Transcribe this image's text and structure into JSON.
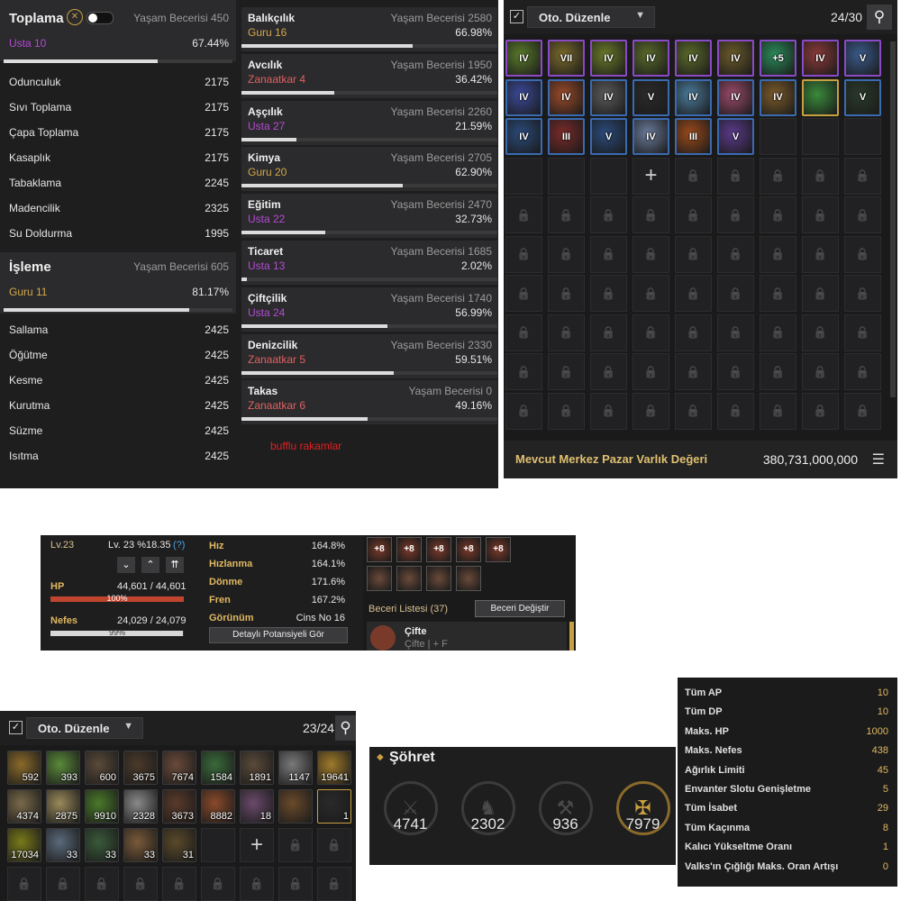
{
  "life": {
    "toplama": {
      "title": "Toplama",
      "life_skill": "Yaşam Becerisi 450",
      "rank": "Usta 10",
      "percent": "67.44%",
      "progress": 0.6744,
      "subs": [
        {
          "name": "Odunculuk",
          "value": "2175"
        },
        {
          "name": "Sıvı Toplama",
          "value": "2175"
        },
        {
          "name": "Çapa Toplama",
          "value": "2175"
        },
        {
          "name": "Kasaplık",
          "value": "2175"
        },
        {
          "name": "Tabaklama",
          "value": "2245"
        },
        {
          "name": "Madencilik",
          "value": "2325"
        },
        {
          "name": "Su Doldurma",
          "value": "1995"
        }
      ]
    },
    "isleme": {
      "title": "İşleme",
      "life_skill": "Yaşam Becerisi 605",
      "rank": "Guru 11",
      "percent": "81.17%",
      "progress": 0.8117,
      "subs": [
        {
          "name": "Sallama",
          "value": "2425"
        },
        {
          "name": "Öğütme",
          "value": "2425"
        },
        {
          "name": "Kesme",
          "value": "2425"
        },
        {
          "name": "Kurutma",
          "value": "2425"
        },
        {
          "name": "Süzme",
          "value": "2425"
        },
        {
          "name": "Isıtma",
          "value": "2425"
        }
      ]
    },
    "skills": [
      {
        "title": "Balıkçılık",
        "life_skill": "Yaşam Becerisi 2580",
        "rank": "Guru 16",
        "rank_kind": "guru",
        "percent": "66.98%",
        "progress": 0.6698
      },
      {
        "title": "Avcılık",
        "life_skill": "Yaşam Becerisi 1950",
        "rank": "Zanaatkar 4",
        "rank_kind": "zan",
        "percent": "36.42%",
        "progress": 0.3642
      },
      {
        "title": "Aşçılık",
        "life_skill": "Yaşam Becerisi 2260",
        "rank": "Usta 27",
        "rank_kind": "usta",
        "percent": "21.59%",
        "progress": 0.2159
      },
      {
        "title": "Kimya",
        "life_skill": "Yaşam Becerisi 2705",
        "rank": "Guru 20",
        "rank_kind": "guru",
        "percent": "62.90%",
        "progress": 0.629
      },
      {
        "title": "Eğitim",
        "life_skill": "Yaşam Becerisi 2470",
        "rank": "Usta 22",
        "rank_kind": "usta",
        "percent": "32.73%",
        "progress": 0.3273
      },
      {
        "title": "Ticaret",
        "life_skill": "Yaşam Becerisi 1685",
        "rank": "Usta 13",
        "rank_kind": "usta",
        "percent": "2.02%",
        "progress": 0.0202
      },
      {
        "title": "Çiftçilik",
        "life_skill": "Yaşam Becerisi 1740",
        "rank": "Usta 24",
        "rank_kind": "usta",
        "percent": "56.99%",
        "progress": 0.5699
      },
      {
        "title": "Denizcilik",
        "life_skill": "Yaşam Becerisi 2330",
        "rank": "Zanaatkar 5",
        "rank_kind": "zan",
        "percent": "59.51%",
        "progress": 0.5951
      },
      {
        "title": "Takas",
        "life_skill": "Yaşam Becerisi 0",
        "rank": "Zanaatkar 6",
        "rank_kind": "zan",
        "percent": "49.16%",
        "progress": 0.4916
      }
    ],
    "note": "bufflu rakamlar"
  },
  "inv1": {
    "sort_label": "Oto. Düzenle",
    "count": "24/30",
    "items": [
      {
        "label": "IV",
        "color": "#5a7a2a",
        "border": "#8a4ac8"
      },
      {
        "label": "VII",
        "color": "#7a6a2a",
        "border": "#8a4ac8"
      },
      {
        "label": "IV",
        "color": "#6a7a2a",
        "border": "#8a4ac8"
      },
      {
        "label": "IV",
        "color": "#5a6a2a",
        "border": "#8a4ac8"
      },
      {
        "label": "IV",
        "color": "#5a6a2a",
        "border": "#8a4ac8"
      },
      {
        "label": "IV",
        "color": "#6a5a2a",
        "border": "#8a4ac8"
      },
      {
        "label": "+5",
        "color": "#2a8a5a",
        "border": "#8a4ac8"
      },
      {
        "label": "IV",
        "color": "#8a3a3a",
        "border": "#8a4ac8"
      },
      {
        "label": "V",
        "color": "#3a5a8a",
        "border": "#8a4ac8"
      },
      {
        "label": "IV",
        "color": "#3a4a9a",
        "border": "#3a6ab0"
      },
      {
        "label": "IV",
        "color": "#9a4a2a",
        "border": "#3a6ab0"
      },
      {
        "label": "IV",
        "color": "#5a5a5a",
        "border": "#3a6ab0"
      },
      {
        "label": "V",
        "color": "#2a2a2a",
        "border": "#3a6ab0"
      },
      {
        "label": "IV",
        "color": "#4a7a9a",
        "border": "#3a6ab0"
      },
      {
        "label": "IV",
        "color": "#9a4a6a",
        "border": "#3a6ab0"
      },
      {
        "label": "IV",
        "color": "#7a5a2a",
        "border": "#3a6ab0"
      },
      {
        "label": "",
        "color": "#3a8a3a",
        "border": "#c9a040"
      },
      {
        "label": "V",
        "color": "#2a3a2a",
        "border": "#3a6ab0"
      },
      {
        "label": "IV",
        "color": "#2a4a7a",
        "border": "#3a6ab0"
      },
      {
        "label": "III",
        "color": "#7a2a2a",
        "border": "#3a6ab0"
      },
      {
        "label": "V",
        "color": "#2a4a7a",
        "border": "#3a6ab0"
      },
      {
        "label": "IV",
        "color": "#6a7a9a",
        "border": "#3a6ab0"
      },
      {
        "label": "III",
        "color": "#9a4a1a",
        "border": "#3a6ab0"
      },
      {
        "label": "V",
        "color": "#5a3a8a",
        "border": "#3a6ab0"
      }
    ],
    "footer_label": "Mevcut Merkez Pazar Varlık Değeri",
    "footer_value": "380,731,000,000",
    "footer_icon": "coins-icon"
  },
  "stats": {
    "lv_label": "Lv.23",
    "lv_detail": "Lv. 23 %18.35",
    "help": "(?)",
    "hp_label": "HP",
    "hp_value": "44,601 / 44,601",
    "hp_pct": "100%",
    "hp_ratio": 1.0,
    "nefes_label": "Nefes",
    "nefes_value": "24,029 / 24,079",
    "nefes_pct": "99%",
    "nefes_ratio": 0.99,
    "hp_color": "#c0452f",
    "nefes_color": "#d8d8d8",
    "rows": [
      {
        "name": "Hız",
        "value": "164.8%"
      },
      {
        "name": "Hızlanma",
        "value": "164.1%"
      },
      {
        "name": "Dönme",
        "value": "171.6%"
      },
      {
        "name": "Fren",
        "value": "167.2%"
      },
      {
        "name": "Görünüm",
        "value": "Cins No 16"
      }
    ],
    "detail_btn": "Detaylı Potansiyeli Gör",
    "skill_icons_row1": [
      "+8",
      "+8",
      "+8",
      "+8",
      "+8"
    ],
    "skill_list": "Beceri Listesi (37)",
    "skill_change": "Beceri Değiştir",
    "skill_name": "Çifte",
    "skill_keys": "Çifte | + F"
  },
  "inv2": {
    "sort_label": "Oto. Düzenle",
    "count": "23/24",
    "items": [
      {
        "qty": "592",
        "color": "#8a6a2a"
      },
      {
        "qty": "393",
        "color": "#5a8a3a"
      },
      {
        "qty": "600",
        "color": "#5a4a3a"
      },
      {
        "qty": "3675",
        "color": "#4a3a2a"
      },
      {
        "qty": "7674",
        "color": "#6a4a3a"
      },
      {
        "qty": "1584",
        "color": "#3a6a3a"
      },
      {
        "qty": "1891",
        "color": "#5a4a3a"
      },
      {
        "qty": "1147",
        "color": "#7a7a7a"
      },
      {
        "qty": "19641",
        "color": "#a07a2a"
      },
      {
        "qty": "4374",
        "color": "#7a6a4a"
      },
      {
        "qty": "2875",
        "color": "#9a8a5a"
      },
      {
        "qty": "9910",
        "color": "#4a7a2a"
      },
      {
        "qty": "2328",
        "color": "#8a8a8a"
      },
      {
        "qty": "3673",
        "color": "#5a3a2a"
      },
      {
        "qty": "8882",
        "color": "#8a4a2a"
      },
      {
        "qty": "18",
        "color": "#6a4a6a"
      },
      {
        "qty": "",
        "color": "#6a4a2a"
      },
      {
        "qty": "1",
        "color": "#2a2a2a"
      },
      {
        "qty": "17034",
        "color": "#7a7a1a"
      },
      {
        "qty": "33",
        "color": "#5a6a7a"
      },
      {
        "qty": "33",
        "color": "#3a5a3a"
      },
      {
        "qty": "33",
        "color": "#7a5a3a"
      },
      {
        "qty": "31",
        "color": "#5a4a2a"
      }
    ]
  },
  "fame": {
    "title": "Şöhret",
    "values": [
      "4741",
      "2302",
      "936",
      "7979"
    ],
    "icons": [
      "crossed-swords-icon",
      "horse-head-icon",
      "gathering-tool-icon",
      "golden-cross-icon"
    ]
  },
  "bonus": [
    {
      "name": "Tüm AP",
      "value": "10"
    },
    {
      "name": "Tüm DP",
      "value": "10"
    },
    {
      "name": "Maks. HP",
      "value": "1000"
    },
    {
      "name": "Maks. Nefes",
      "value": "438"
    },
    {
      "name": "Ağırlık Limiti",
      "value": "45"
    },
    {
      "name": "Envanter Slotu Genişletme",
      "value": "5"
    },
    {
      "name": "Tüm İsabet",
      "value": "29"
    },
    {
      "name": "Tüm Kaçınma",
      "value": "8"
    },
    {
      "name": "Kalıcı Yükseltme Oranı",
      "value": "1"
    },
    {
      "name": "Valks'ın Çığlığı Maks. Oran Artışı",
      "value": "0"
    }
  ]
}
